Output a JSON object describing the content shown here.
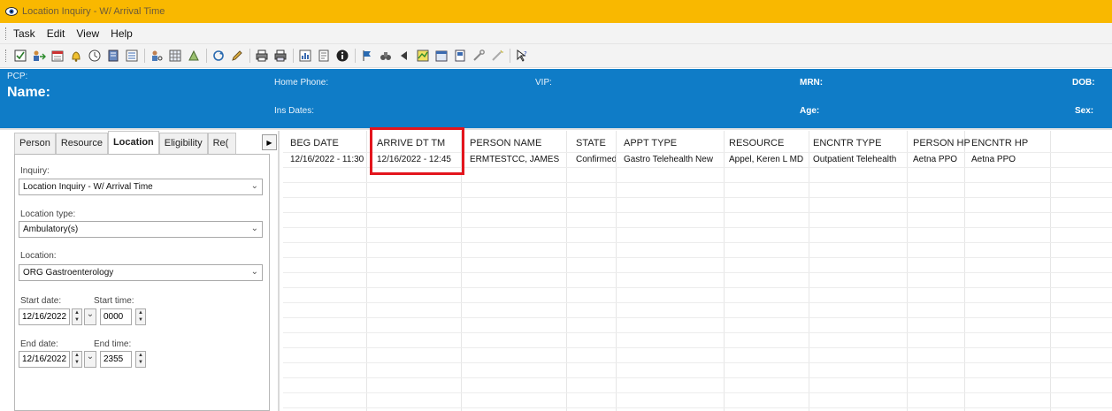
{
  "window": {
    "title": "Location Inquiry - W/ Arrival Time"
  },
  "menu": [
    "Task",
    "Edit",
    "View",
    "Help"
  ],
  "toolbar_icons": [
    "checkbox-icon",
    "person-transfer-icon",
    "calendar-icon",
    "bell-icon",
    "clock-icon",
    "book-icon",
    "list-icon",
    "search-person-icon",
    "grid-icon",
    "request-icon",
    "refresh-icon",
    "pencil-icon",
    "printer-icon",
    "printer2-icon",
    "chart-icon",
    "note-icon",
    "info-icon",
    "flag-icon",
    "binoculars-icon",
    "back-icon",
    "map-icon",
    "calendar2-icon",
    "document-icon",
    "tools-icon",
    "wand-icon",
    "help-arrow-icon"
  ],
  "banner": {
    "pcp_label": "PCP:",
    "name_label": "Name:",
    "home_phone_label": "Home Phone:",
    "ins_dates_label": "Ins Dates:",
    "vip_label": "VIP:",
    "mrn_label": "MRN:",
    "age_label": "Age:",
    "dob_label": "DOB:",
    "sex_label": "Sex:"
  },
  "tabs": [
    "Person",
    "Resource",
    "Location",
    "Eligibility",
    "Re("
  ],
  "active_tab": "Location",
  "form": {
    "inquiry_label": "Inquiry:",
    "inquiry_value": "Location Inquiry - W/ Arrival Time",
    "location_type_label": "Location type:",
    "location_type_value": "Ambulatory(s)",
    "location_label": "Location:",
    "location_value": "ORG Gastroenterology",
    "start_date_label": "Start date:",
    "start_date_value": "12/16/2022",
    "start_time_label": "Start time:",
    "start_time_value": "0000",
    "end_date_label": "End date:",
    "end_date_value": "12/16/2022",
    "end_time_label": "End time:",
    "end_time_value": "2355"
  },
  "table": {
    "columns": [
      "BEG DATE",
      "ARRIVE DT TM",
      "PERSON NAME",
      "STATE",
      "APPT TYPE",
      "RESOURCE",
      "ENCNTR TYPE",
      "PERSON HP",
      "ENCNTR HP"
    ],
    "rows": [
      [
        "12/16/2022 - 11:30",
        "12/16/2022 - 12:45",
        "ERMTESTCC, JAMES",
        "Confirmed",
        "Gastro Telehealth New",
        "Appel, Keren L MD",
        "Outpatient Telehealth",
        "Aetna PPO",
        "Aetna PPO"
      ]
    ]
  },
  "highlight_color": "#e3151d",
  "banner_color": "#0f7cc7",
  "titlebar_color": "#f9b800"
}
